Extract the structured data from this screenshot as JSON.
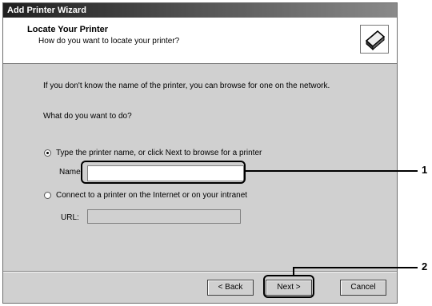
{
  "window": {
    "title": "Add Printer Wizard"
  },
  "header": {
    "title": "Locate Your Printer",
    "subtitle": "How do you want to locate your printer?"
  },
  "body": {
    "intro": "If you don't know the name of the printer, you can browse for one on the network.",
    "question": "What do you want to do?"
  },
  "options": {
    "type_name": {
      "label": "Type the printer name, or click Next to browse for a printer",
      "selected": true
    },
    "connect_url": {
      "label": "Connect to a printer on the Internet or on your intranet",
      "selected": false
    }
  },
  "fields": {
    "name": {
      "label": "Name:",
      "value": ""
    },
    "url": {
      "label": "URL:",
      "value": ""
    }
  },
  "buttons": {
    "back": "< Back",
    "next": "Next >",
    "cancel": "Cancel"
  },
  "callouts": {
    "one": "1",
    "two": "2"
  },
  "icons": {
    "header": "printer-icon"
  }
}
